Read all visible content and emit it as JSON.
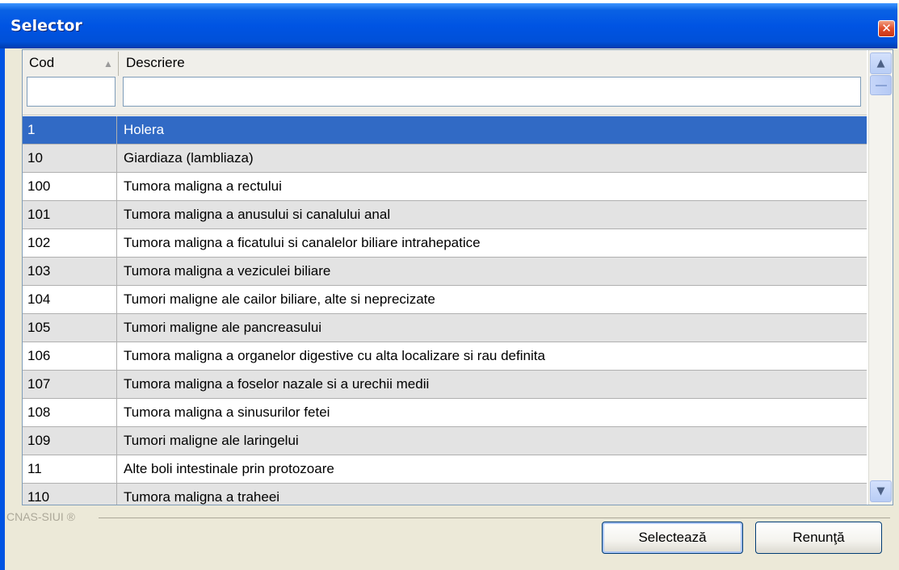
{
  "window": {
    "title": "Selector",
    "close_glyph": "✕"
  },
  "grid": {
    "columns": [
      "Cod",
      "Descriere"
    ],
    "sort_indicator": "▲",
    "filter": {
      "cod": "",
      "descriere": ""
    },
    "selected_index": 0,
    "rows": [
      {
        "cod": "1",
        "descriere": "Holera"
      },
      {
        "cod": "10",
        "descriere": "Giardiaza (lambliaza)"
      },
      {
        "cod": "100",
        "descriere": "Tumora maligna a rectului"
      },
      {
        "cod": "101",
        "descriere": "Tumora maligna a anusului si canalului anal"
      },
      {
        "cod": "102",
        "descriere": "Tumora maligna a ficatului si canalelor biliare intrahepatice"
      },
      {
        "cod": "103",
        "descriere": "Tumora maligna a veziculei biliare"
      },
      {
        "cod": "104",
        "descriere": "Tumori maligne ale cailor biliare, alte si neprecizate"
      },
      {
        "cod": "105",
        "descriere": "Tumori maligne ale pancreasului"
      },
      {
        "cod": "106",
        "descriere": "Tumora maligna a organelor digestive cu alta localizare si rau definita"
      },
      {
        "cod": "107",
        "descriere": "Tumora maligna a foselor nazale si a urechii medii"
      },
      {
        "cod": "108",
        "descriere": "Tumora maligna a sinusurilor fetei"
      },
      {
        "cod": "109",
        "descriere": "Tumori maligne ale laringelui"
      },
      {
        "cod": "11",
        "descriere": "Alte boli intestinale prin protozoare"
      },
      {
        "cod": "110",
        "descriere": "Tumora maligna a traheei"
      }
    ]
  },
  "footer": {
    "brand": "CNAS-SIUI ®"
  },
  "buttons": {
    "select": "Selectează",
    "cancel": "Renunţă"
  },
  "colors": {
    "titlebar": "#0054e3",
    "selected_row": "#316ac5",
    "alt_row": "#e3e3e3"
  }
}
